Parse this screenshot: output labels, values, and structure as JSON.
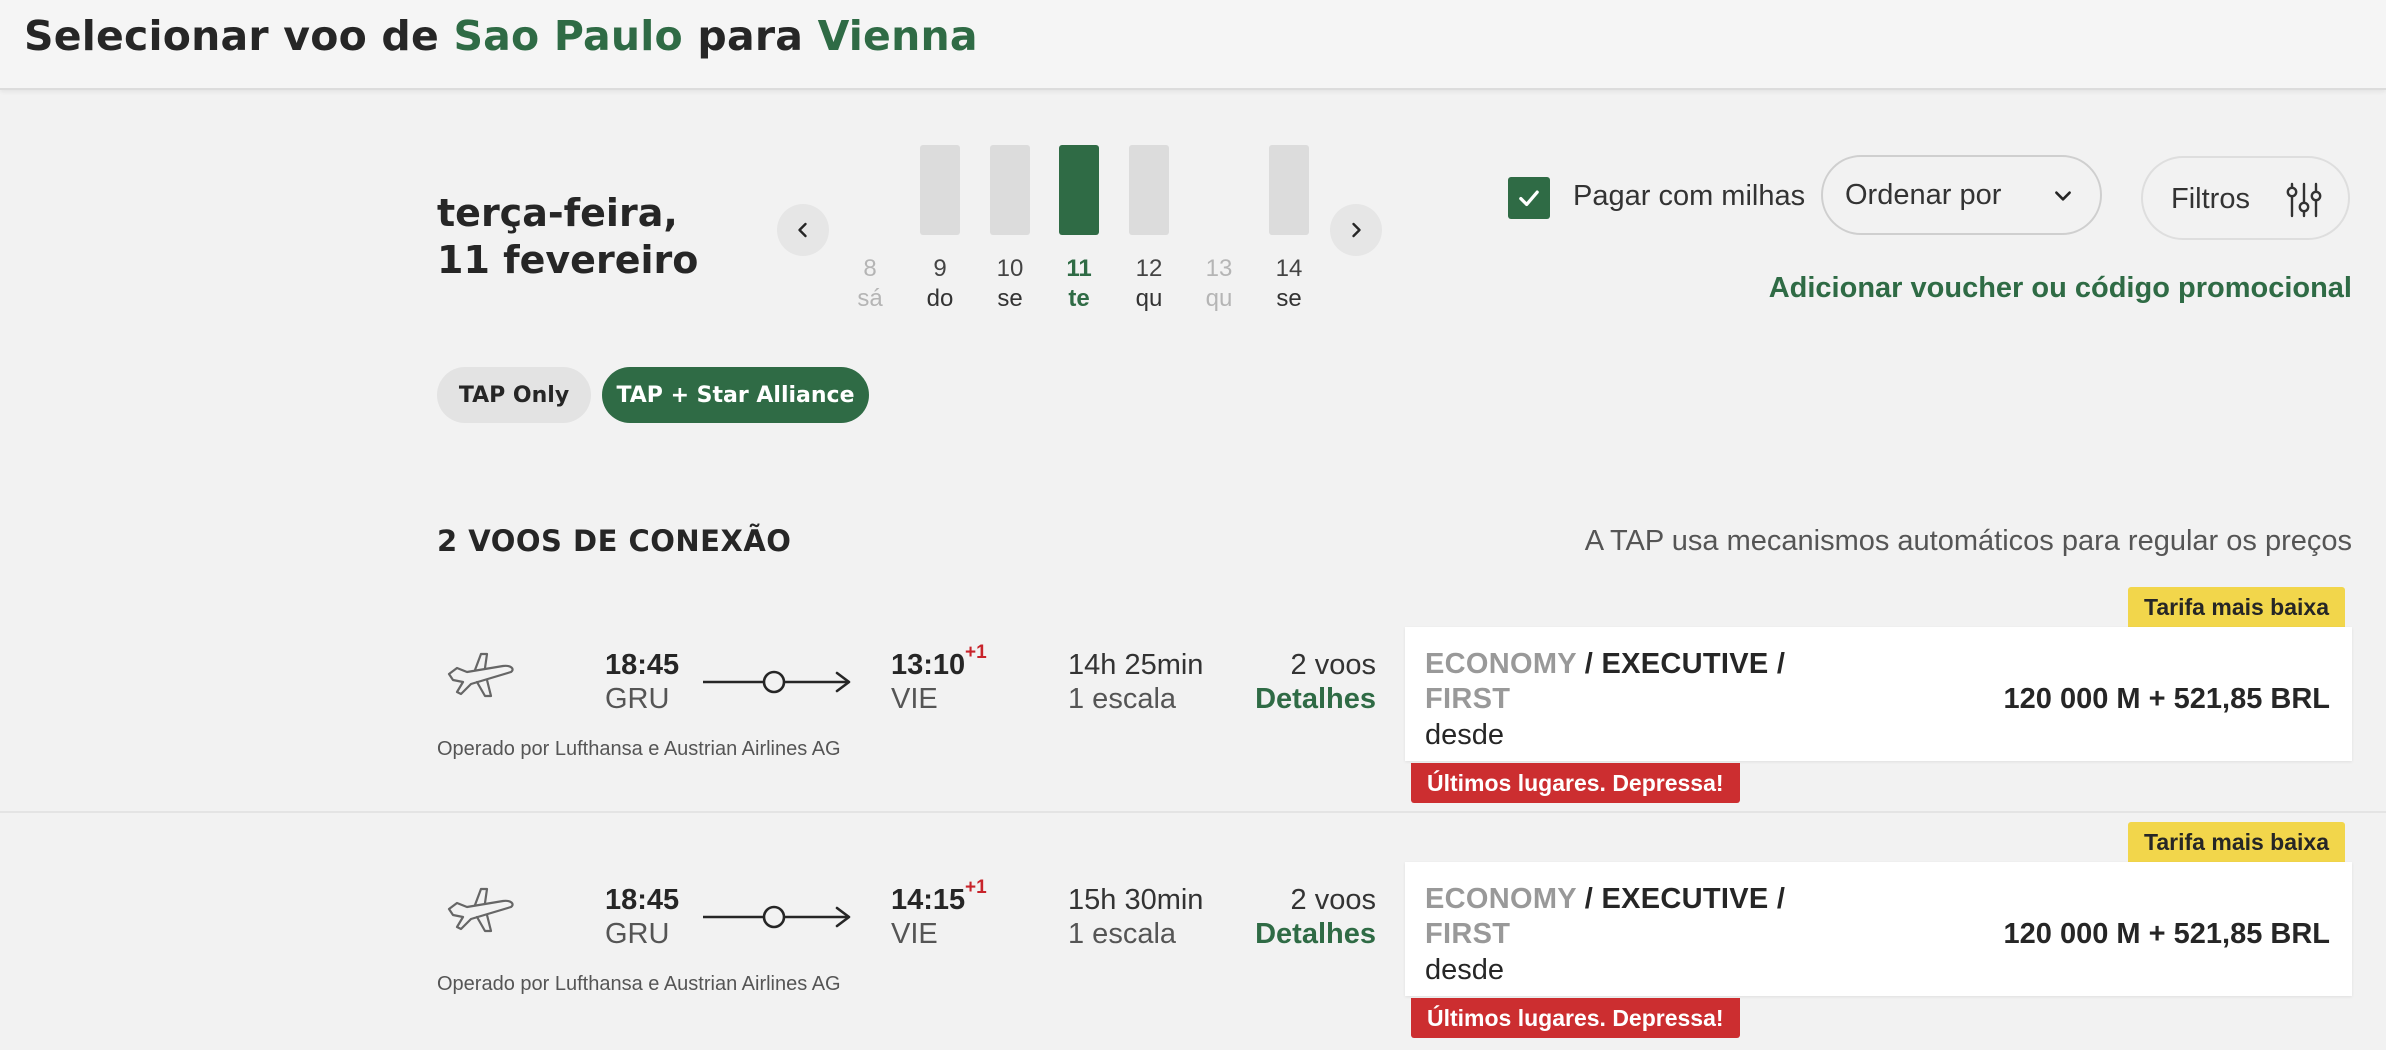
{
  "header": {
    "title_prefix": "Selecionar voo de",
    "origin": "Sao Paulo",
    "connector": "para",
    "destination": "Vienna"
  },
  "date_selector": {
    "weekday": "terça-feira,",
    "date": "11 fevereiro",
    "days": [
      {
        "num": "8",
        "dow": "sá",
        "has_flights": false,
        "selected": false
      },
      {
        "num": "9",
        "dow": "do",
        "has_flights": true,
        "selected": false
      },
      {
        "num": "10",
        "dow": "se",
        "has_flights": true,
        "selected": false
      },
      {
        "num": "11",
        "dow": "te",
        "has_flights": true,
        "selected": true
      },
      {
        "num": "12",
        "dow": "qu",
        "has_flights": true,
        "selected": false
      },
      {
        "num": "13",
        "dow": "qu",
        "has_flights": false,
        "selected": false
      },
      {
        "num": "14",
        "dow": "se",
        "has_flights": true,
        "selected": false
      }
    ]
  },
  "options": {
    "pay_with_miles_label": "Pagar com milhas",
    "pay_with_miles_checked": true,
    "sort_label": "Ordenar por",
    "filters_label": "Filtros",
    "voucher_link": "Adicionar voucher ou código promocional"
  },
  "alliance_toggle": {
    "tap_only": "TAP Only",
    "tap_star": "TAP + Star Alliance",
    "active": "TAP + Star Alliance"
  },
  "results": {
    "section_title": "2 VOOS DE CONEXÃO",
    "pricing_note": "A TAP usa mecanismos automáticos para regular os preços"
  },
  "flights": [
    {
      "dep_time": "18:45",
      "dep_code": "GRU",
      "arr_time": "13:10",
      "arr_plus": "+1",
      "arr_code": "VIE",
      "duration": "14h 25min",
      "stops": "1 escala",
      "num_flights": "2 voos",
      "details": "Detalhes",
      "operated_by": "Operado por Lufthansa e Austrian Airlines AG",
      "badge_top": "Tarifa mais baixa",
      "fare_economy": "ECONOMY",
      "fare_sep1": " / ",
      "fare_executive": "EXECUTIVE",
      "fare_sep2": " /",
      "fare_first": "FIRST",
      "fare_from": "desde",
      "price": "120 000 M + 521,85 BRL",
      "badge_bottom": "Últimos lugares. Depressa!"
    },
    {
      "dep_time": "18:45",
      "dep_code": "GRU",
      "arr_time": "14:15",
      "arr_plus": "+1",
      "arr_code": "VIE",
      "duration": "15h 30min",
      "stops": "1 escala",
      "num_flights": "2 voos",
      "details": "Detalhes",
      "operated_by": "Operado por Lufthansa e Austrian Airlines AG",
      "badge_top": "Tarifa mais baixa",
      "fare_economy": "ECONOMY",
      "fare_sep1": " / ",
      "fare_executive": "EXECUTIVE",
      "fare_sep2": " /",
      "fare_first": "FIRST",
      "fare_from": "desde",
      "price": "120 000 M + 521,85 BRL",
      "badge_bottom": "Últimos lugares. Depressa!"
    }
  ],
  "colors": {
    "brand_green": "#2f6b45",
    "badge_yellow": "#f2d64b",
    "badge_red": "#cc2e30"
  },
  "icons": [
    "chevron-left-icon",
    "chevron-right-icon",
    "check-icon",
    "chevron-down-icon",
    "sliders-icon",
    "plane-icon"
  ]
}
